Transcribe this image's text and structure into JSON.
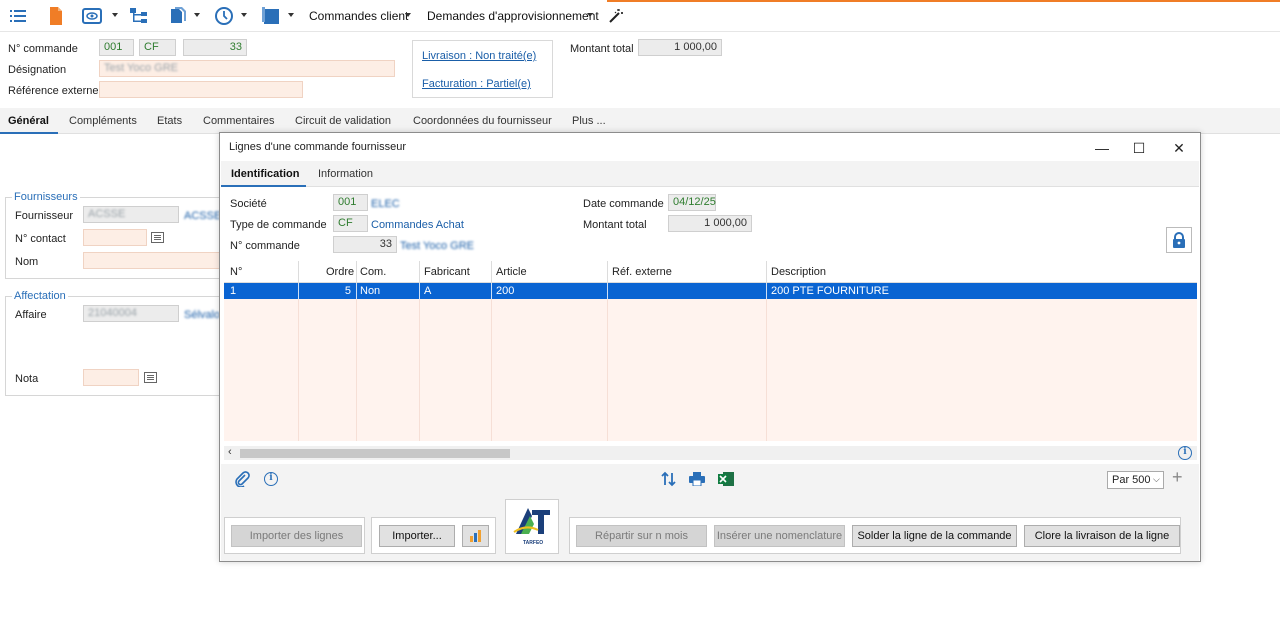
{
  "toolbar": {
    "menus": [
      "Commandes client",
      "Demandes d'approvisionnement"
    ],
    "icons": [
      "list-icon",
      "document-icon",
      "view-icon",
      "tree-icon",
      "copy-icon",
      "clock-icon",
      "window-icon",
      "magic-wand-icon"
    ]
  },
  "header": {
    "order_number_label": "N° commande",
    "order_company": "001",
    "order_type": "CF",
    "order_number": "33",
    "designation_label": "Désignation",
    "designation_value": "Test Yoco GRE",
    "external_ref_label": "Référence externe",
    "external_ref_value": "",
    "delivery_link": "Livraison : Non traité(e)",
    "billing_link": "Facturation : Partiel(e)",
    "total_label": "Montant total",
    "total_value": "1 000,00"
  },
  "main_tabs": [
    "Général",
    "Compléments",
    "Etats",
    "Commentaires",
    "Circuit de validation",
    "Coordonnées du fournisseur",
    "Plus ..."
  ],
  "suppliers": {
    "title": "Fournisseurs",
    "supplier_label": "Fournisseur",
    "supplier_code": "ACSSE",
    "supplier_name": "ACSSE",
    "contact_label": "N° contact",
    "name_label": "Nom"
  },
  "assignment": {
    "title": "Affectation",
    "project_label": "Affaire",
    "project_code": "21040004",
    "project_name": "Sélvalo",
    "note_label": "Nota"
  },
  "modal": {
    "title": "Lignes d'une commande fournisseur",
    "tabs": [
      "Identification",
      "Information"
    ],
    "company_label": "Société",
    "company_code": "001",
    "company_name": "ELEC",
    "order_type_label": "Type de commande",
    "order_type_code": "CF",
    "order_type_name": "Commandes Achat",
    "order_number_label": "N° commande",
    "order_number": "33",
    "order_designation": "Test Yoco GRE",
    "order_date_label": "Date commande",
    "order_date": "04/12/25",
    "total_label": "Montant total",
    "total_value": "1 000,00",
    "grid_columns": [
      "N°",
      "Ordre",
      "Com.",
      "Fabricant",
      "Article",
      "Réf. externe",
      "Description"
    ],
    "grid_rows": [
      [
        "1",
        "5",
        "Non",
        "A",
        "200",
        "",
        "200 PTE FOURNITURE"
      ]
    ],
    "page_size": "Par 500",
    "buttons": {
      "import_lines": "Importer des lignes",
      "import": "Importer...",
      "logo_text": "TARFEO",
      "split_months": "Répartir sur n mois",
      "insert_bom": "Insérer une nomenclature",
      "settle_line": "Solder la ligne de la commande",
      "close_delivery": "Clore la livraison de la ligne"
    },
    "window_controls": [
      "—",
      "☐",
      "✕"
    ]
  },
  "colors": {
    "accent": "#2a6fb8",
    "selection": "#0a64d2",
    "toolbar_orange": "#f07d26",
    "pink_field": "#fdeee5",
    "grid_body": "#fff3ee"
  }
}
